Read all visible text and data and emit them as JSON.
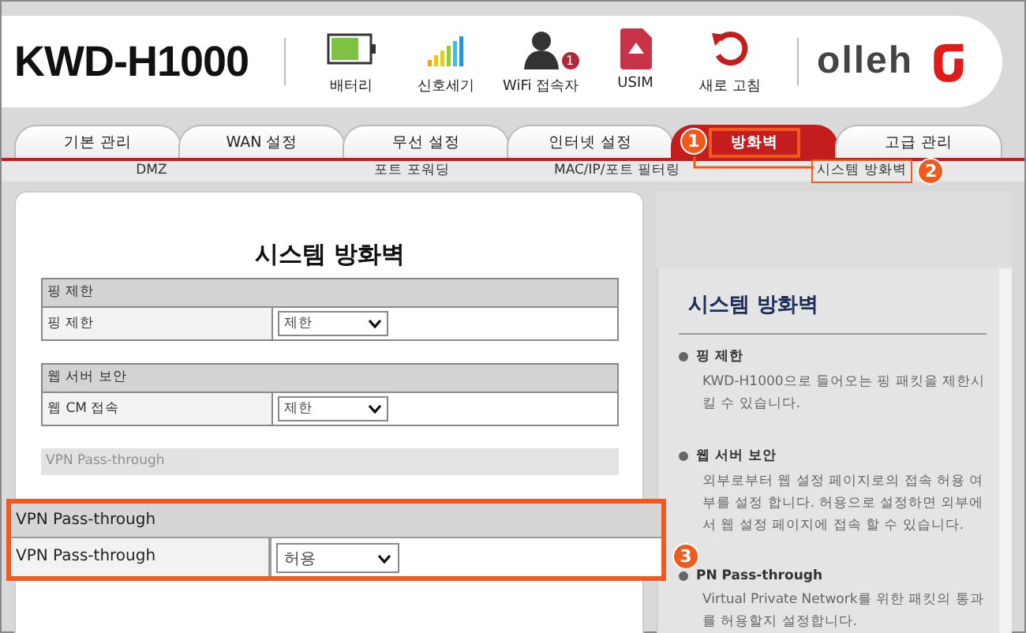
{
  "header": {
    "model": "KWD-H1000",
    "status_items": [
      {
        "kind": "battery",
        "label": "배터리"
      },
      {
        "kind": "signal",
        "label": "신호세기"
      },
      {
        "kind": "users",
        "label": "WiFi 접속자",
        "badge": "1"
      },
      {
        "kind": "usim",
        "label": "USIM"
      },
      {
        "kind": "refresh",
        "label": "새로 고침"
      }
    ],
    "brand": "olleh"
  },
  "tabs": [
    {
      "label": "기본 관리",
      "selected": false
    },
    {
      "label": "WAN 설정",
      "selected": false
    },
    {
      "label": "무선 설정",
      "selected": false
    },
    {
      "label": "인터넷 설정",
      "selected": false
    },
    {
      "label": "방화벽",
      "selected": true,
      "callout": "1"
    },
    {
      "label": "고급 관리",
      "selected": false
    }
  ],
  "subtabs": [
    {
      "label": "DMZ",
      "selected": false
    },
    {
      "label": "포트 포워딩",
      "selected": false
    },
    {
      "label": "MAC/IP/포트 필터링",
      "selected": false
    },
    {
      "label": "시스템 방화벽",
      "selected": true,
      "callout": "2"
    }
  ],
  "panel": {
    "title": "시스템 방화벽",
    "sections": [
      {
        "heading": "핑 제한",
        "rows": [
          {
            "label": "핑 제한",
            "value": "제한"
          }
        ]
      },
      {
        "heading": "웹 서버 보안",
        "rows": [
          {
            "label": "웹 CM 접속",
            "value": "제한"
          }
        ]
      }
    ],
    "faded_heading": "VPN Pass-through",
    "zoomed": {
      "callout": "3",
      "heading": "VPN Pass-through",
      "rows": [
        {
          "label": "VPN Pass-through",
          "value": "허용"
        }
      ]
    }
  },
  "help": {
    "title": "시스템 방화벽",
    "items": [
      {
        "heading": "핑 제한",
        "text": "KWD-H1000으로 들어오는 핑 패킷을 제한시킬 수 있습니다."
      },
      {
        "heading": "웹 서버 보안",
        "text": "외부로부터 웹 설정 페이지로의 접속 허용 여부를 설정 합니다. 허용으로 설정하면 외부에서 웹 설정 페이지에 접속 할 수 있습니다."
      },
      {
        "heading": "PN Pass-through",
        "text": "Virtual Private Network를 위한 패킷의 통과를 허용할지 설정합니다."
      }
    ]
  }
}
